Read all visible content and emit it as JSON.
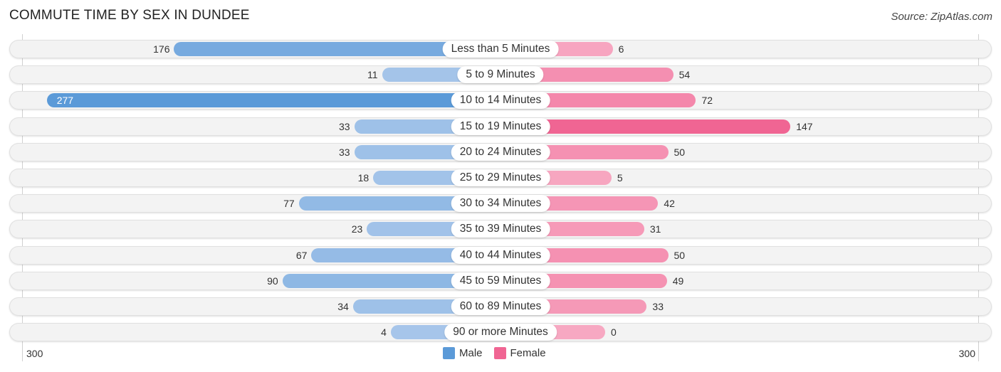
{
  "title": "COMMUTE TIME BY SEX IN DUNDEE",
  "source": "Source: ZipAtlas.com",
  "colors": {
    "male_strong": "#5b9ad8",
    "male_light": "#a7c6ea",
    "female_strong": "#f06593",
    "female_light": "#f7a8c2"
  },
  "chart_data": {
    "type": "bar",
    "orientation": "horizontal-diverging",
    "title": "COMMUTE TIME BY SEX IN DUNDEE",
    "categories": [
      "Less than 5 Minutes",
      "5 to 9 Minutes",
      "10 to 14 Minutes",
      "15 to 19 Minutes",
      "20 to 24 Minutes",
      "25 to 29 Minutes",
      "30 to 34 Minutes",
      "35 to 39 Minutes",
      "40 to 44 Minutes",
      "45 to 59 Minutes",
      "60 to 89 Minutes",
      "90 or more Minutes"
    ],
    "series": [
      {
        "name": "Male",
        "values": [
          176,
          11,
          277,
          33,
          33,
          18,
          77,
          23,
          67,
          90,
          34,
          4
        ]
      },
      {
        "name": "Female",
        "values": [
          6,
          54,
          72,
          147,
          50,
          5,
          42,
          31,
          50,
          49,
          33,
          0
        ]
      }
    ],
    "xlim": [
      -300,
      300
    ],
    "axis_tick_labels": {
      "left": "300",
      "right": "300"
    },
    "legend": {
      "position": "bottom-center",
      "entries": [
        "Male",
        "Female"
      ]
    }
  }
}
